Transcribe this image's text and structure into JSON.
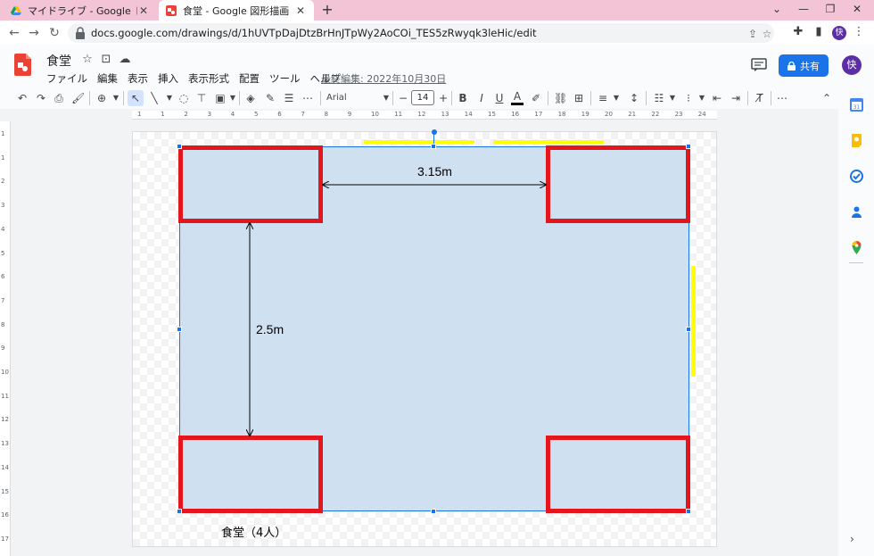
{
  "browser": {
    "tabs": [
      {
        "title": "マイドライブ - Google ドライブ",
        "icon": "google-drive-icon"
      },
      {
        "title": "食堂 - Google 図形描画",
        "icon": "google-drawings-icon"
      }
    ],
    "new_tab_label": "+",
    "url": "docs.google.com/drawings/d/1hUVTpDajDtzBrHnJTpWy2AoCOi_TES5zRwyqk3leHic/edit",
    "profile_initial": "快"
  },
  "app": {
    "doc_title": "食堂",
    "menu": [
      "ファイル",
      "編集",
      "表示",
      "挿入",
      "表示形式",
      "配置",
      "ツール",
      "ヘルプ"
    ],
    "last_edit": "最終編集: 2022年10月30日",
    "share_label": "共有",
    "avatar_initial": "快"
  },
  "toolbar": {
    "font_name": "Arial",
    "font_size": "14",
    "minus": "−",
    "plus": "+"
  },
  "ruler": {
    "h_numbers": [
      "1",
      "1",
      "2",
      "3",
      "4",
      "5",
      "6",
      "7",
      "8",
      "9",
      "10",
      "11",
      "12",
      "13",
      "14",
      "15",
      "16",
      "17",
      "18",
      "19",
      "20",
      "21",
      "22",
      "23",
      "24"
    ],
    "v_numbers": [
      "1",
      "1",
      "2",
      "3",
      "4",
      "5",
      "6",
      "7",
      "8",
      "9",
      "10",
      "11",
      "12",
      "13",
      "14",
      "15",
      "16",
      "17"
    ]
  },
  "drawing": {
    "width_label": "3.15m",
    "height_label": "2.5m",
    "caption": "食堂（4人）",
    "colors": {
      "room_fill": "#cfe0f1",
      "table_border": "#e3151d",
      "highlight": "#ffff00",
      "selection": "#1a73e8"
    }
  }
}
